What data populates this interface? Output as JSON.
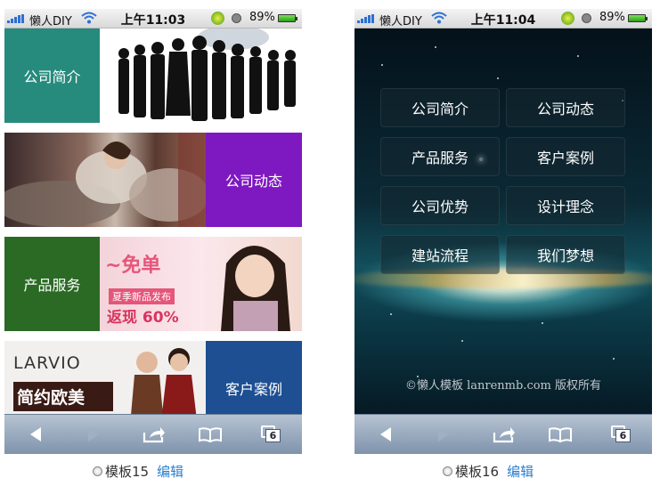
{
  "phones": [
    {
      "status": {
        "carrier": "懒人DIY",
        "time": "上午11:03",
        "battery": "89%"
      },
      "tiles": [
        {
          "label": "公司简介",
          "color": "#268b7d"
        },
        {
          "label": "公司动态",
          "color": "#7e18c0"
        },
        {
          "label": "产品服务",
          "color": "#2a6a24"
        },
        {
          "label": "客户案例",
          "color": "#1d4f92"
        }
      ],
      "ad_banner": {
        "line1": "~免单",
        "line2": "夏季新品发布",
        "line3": "返现 60%"
      },
      "brand_banner": {
        "logo": "LARVIO",
        "slogan": "简约欧美"
      },
      "caption": {
        "label": "模板15",
        "edit": "编辑"
      }
    },
    {
      "status": {
        "carrier": "懒人DIY",
        "time": "上午11:04",
        "battery": "89%"
      },
      "menu": [
        "公司简介",
        "公司动态",
        "产品服务",
        "客户案例",
        "公司优势",
        "设计理念",
        "建站流程",
        "我们梦想"
      ],
      "copyright": "©懒人模板 lanrenmb.com 版权所有",
      "caption": {
        "label": "模板16",
        "edit": "编辑"
      }
    }
  ],
  "toolbar": {
    "tabs_count": "6",
    "icons": [
      "back-arrow-icon",
      "forward-arrow-icon",
      "share-icon",
      "bookmarks-icon",
      "tabs-icon"
    ]
  }
}
